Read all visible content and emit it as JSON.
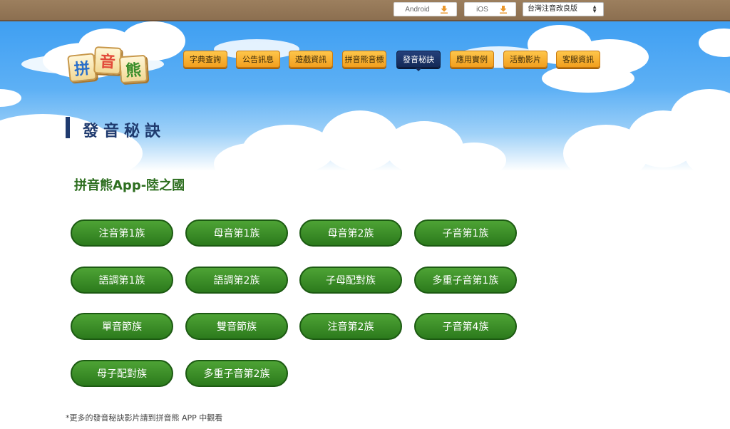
{
  "download": {
    "android_label": "Android",
    "ios_label": "iOS",
    "download_icon": "download-icon",
    "icon_color": "#e9962b"
  },
  "version_select": {
    "selected": "台灣注音改良版"
  },
  "logo": {
    "chars": [
      "拼",
      "音",
      "熊"
    ],
    "colors": [
      "#2a6fc9",
      "#e24a3a",
      "#3a8e2a"
    ]
  },
  "nav": {
    "items": [
      {
        "label": "字典查詢"
      },
      {
        "label": "公告訊息"
      },
      {
        "label": "遊戲資訊"
      },
      {
        "label": "拼音熊音標"
      },
      {
        "label": "發音秘訣",
        "active": true
      },
      {
        "label": "應用實例"
      },
      {
        "label": "活動影片"
      },
      {
        "label": "客服資訊"
      }
    ]
  },
  "page": {
    "title": "發音秘訣",
    "section_title": "拼音熊App-陸之國",
    "footnote": "*更多的發音秘訣影片請到拼音熊 APP 中觀看"
  },
  "groups": [
    "注音第1族",
    "母音第1族",
    "母音第2族",
    "子音第1族",
    "語調第1族",
    "語調第2族",
    "子母配對族",
    "多重子音第1族",
    "單音節族",
    "雙音節族",
    "注音第2族",
    "子音第4族",
    "母子配對族",
    "多重子音第2族"
  ],
  "colors": {
    "accent_green": "#2c7a1c",
    "nav_orange": "#f29f1e",
    "nav_active": "#132a57",
    "title_navy": "#1f3a6e"
  }
}
